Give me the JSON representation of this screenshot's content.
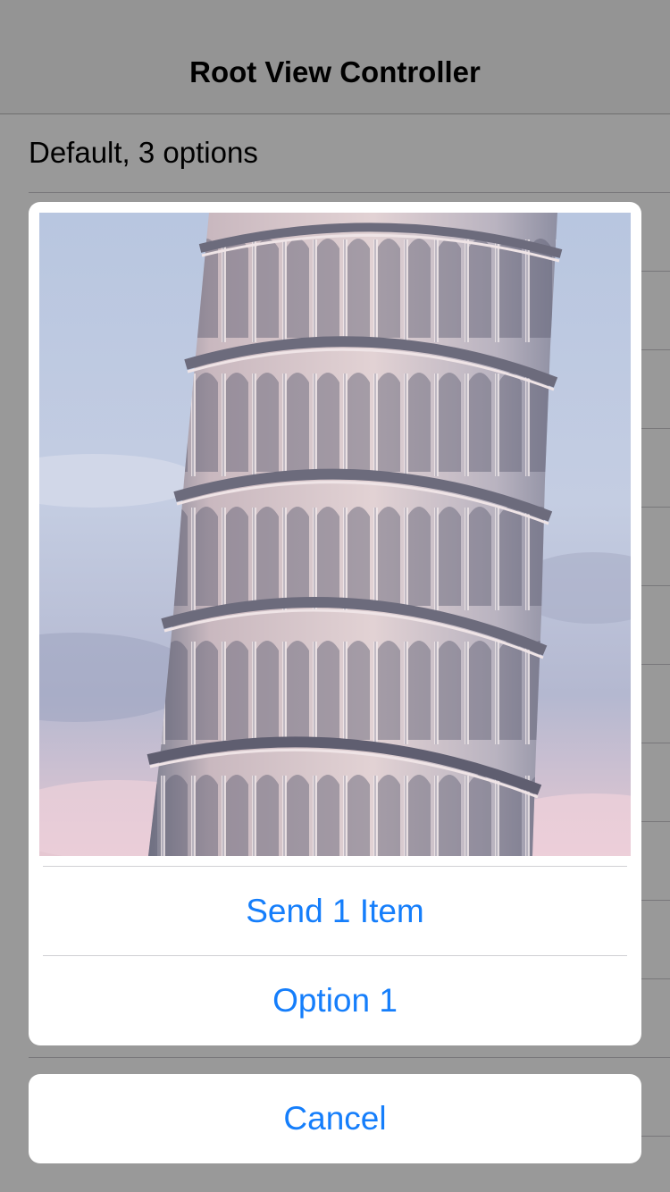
{
  "nav": {
    "title": "Root View Controller"
  },
  "table": {
    "rows": [
      {
        "label": "Default, 3 options"
      },
      {
        "label": ""
      },
      {
        "label": ""
      },
      {
        "label": ""
      },
      {
        "label": ""
      },
      {
        "label": ""
      },
      {
        "label": ""
      },
      {
        "label": ""
      },
      {
        "label": ""
      },
      {
        "label": ""
      },
      {
        "label": ""
      },
      {
        "label": ""
      },
      {
        "label": ""
      }
    ]
  },
  "action_sheet": {
    "preview_image": "leaning-tower-photo",
    "actions": [
      {
        "label": "Send 1 Item"
      },
      {
        "label": "Option 1"
      }
    ],
    "cancel_label": "Cancel"
  },
  "colors": {
    "accent": "#157efb",
    "overlay": "rgba(0,0,0,0.4)"
  }
}
